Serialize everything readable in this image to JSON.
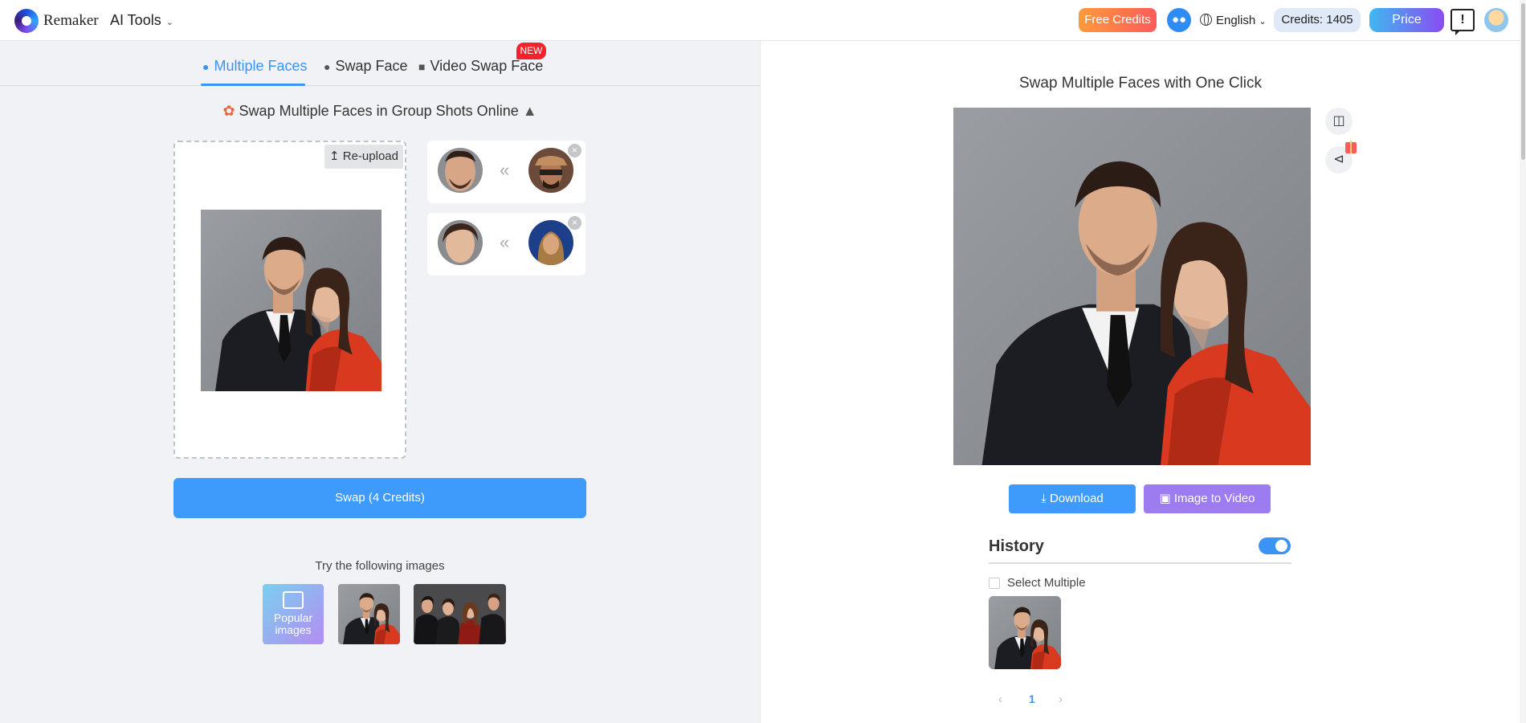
{
  "header": {
    "brand": "Remaker",
    "ai_tools": "AI Tools",
    "free_credits": "Free Credits",
    "language": "English",
    "credits": "Credits: 1405",
    "price": "Price",
    "feedback_symbol": "!"
  },
  "tabs": [
    {
      "label": "Multiple Faces",
      "icon": "users-icon",
      "active": true
    },
    {
      "label": "Swap Face",
      "icon": "user-icon"
    },
    {
      "label": "Video Swap Face",
      "icon": "video-camera-icon"
    }
  ],
  "new_badge": "NEW",
  "subtitle": "Swap Multiple Faces in Group Shots Online",
  "upload": {
    "reupload": "Re-upload"
  },
  "face_pairs": [
    {
      "arrow": "«",
      "close": "×"
    },
    {
      "arrow": "«",
      "close": "×"
    }
  ],
  "swap_button": "Swap (4 Credits)",
  "try_text": "Try the following images",
  "popular_label_1": "Popular",
  "popular_label_2": "images",
  "right": {
    "title": "Swap Multiple Faces with One Click",
    "download": "Download",
    "image_to_video": "Image to Video",
    "history": "History",
    "history_toggle_on": true,
    "select_multiple": "Select Multiple",
    "page": "1",
    "prev": "‹",
    "next": "›"
  },
  "colors": {
    "accent": "#3e9bfb",
    "left_bg": "#f0f2f6",
    "price_gradient": [
      "#3fb8f0",
      "#8a4cf2"
    ],
    "free_credits_gradient": [
      "#ff9a3c",
      "#ff5b5b"
    ],
    "image_to_video": "#9d7cf2",
    "new_badge": "#f5222d"
  }
}
